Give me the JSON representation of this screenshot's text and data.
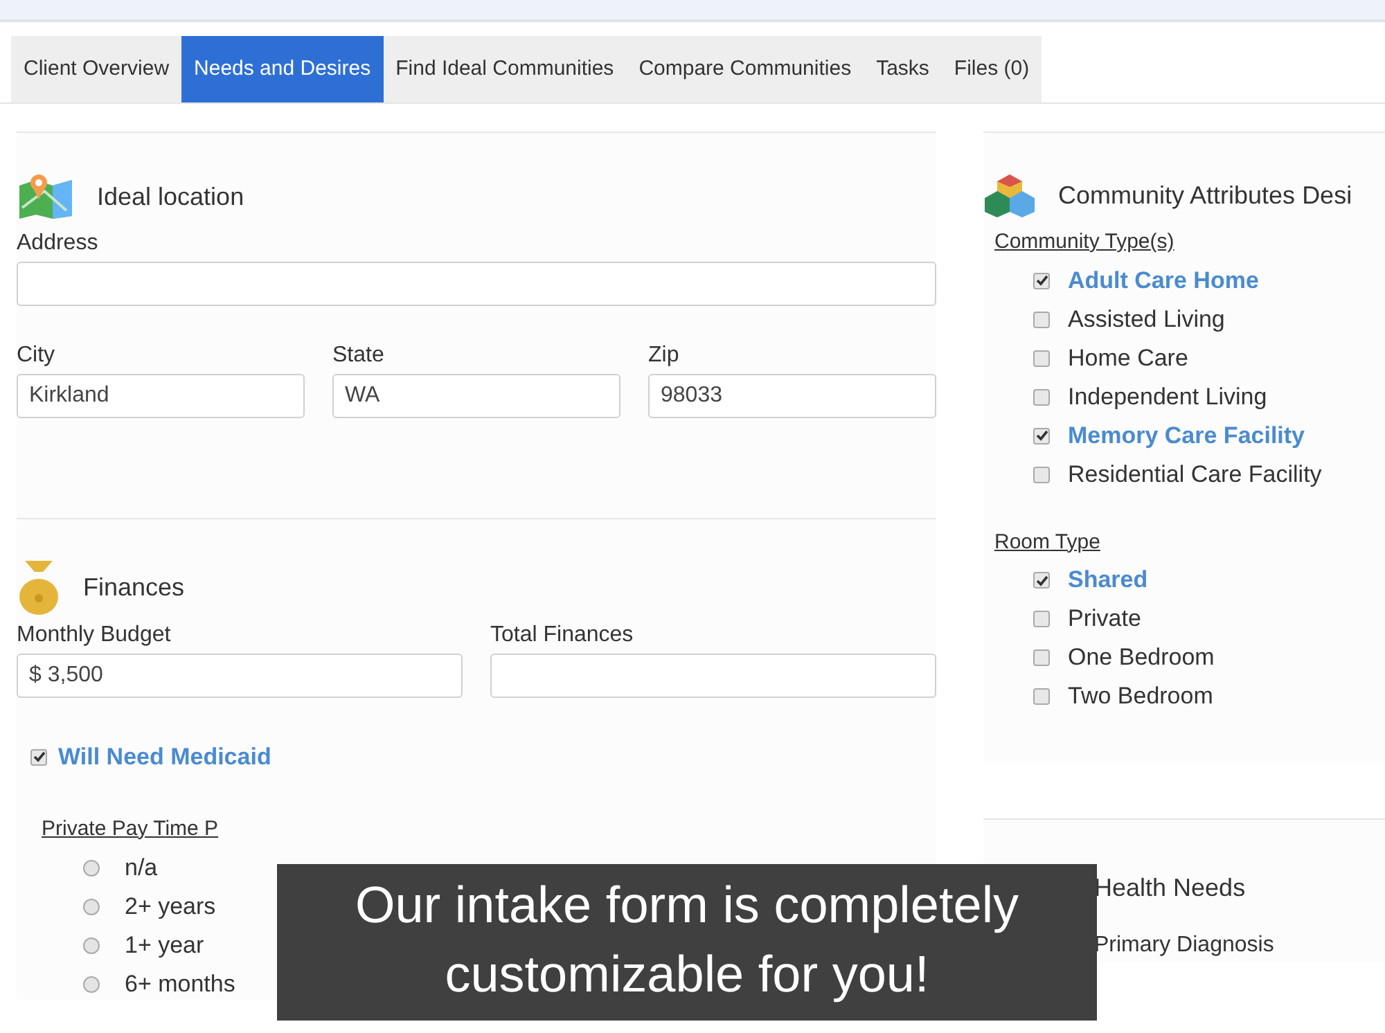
{
  "tabs": [
    {
      "label": "Client Overview",
      "selected": false
    },
    {
      "label": "Needs and Desires",
      "selected": true
    },
    {
      "label": "Find Ideal Communities",
      "selected": false
    },
    {
      "label": "Compare Communities",
      "selected": false
    },
    {
      "label": "Tasks",
      "selected": false
    },
    {
      "label": "Files (0)",
      "selected": false
    }
  ],
  "location": {
    "title": "Ideal location",
    "fields": [
      {
        "label": "Address"
      },
      {
        "label": "City",
        "value": "Kirkland"
      },
      {
        "label": "State",
        "value": "WA"
      },
      {
        "label": "Zip",
        "value": "98033"
      }
    ]
  },
  "finances": {
    "title": "Finances",
    "fields": [
      {
        "label": "Monthly Budget",
        "value": "$ 3,500"
      },
      {
        "label": "Total Finances"
      }
    ],
    "medicaid": {
      "label": "Will Need Medicaid",
      "checked": true
    },
    "private_pay": {
      "title": "Private Pay Time P",
      "options": [
        {
          "label": "n/a",
          "selected": false
        },
        {
          "label": "2+ years",
          "selected": false
        },
        {
          "label": "1+ year",
          "selected": false
        },
        {
          "label": "6+ months",
          "selected": false
        }
      ]
    }
  },
  "attributes": {
    "title": "Community Attributes Desi",
    "groups": [
      {
        "title": "Community Type(s)",
        "items": [
          {
            "label": "Adult Care Home",
            "checked": true
          },
          {
            "label": "Assisted Living",
            "checked": false
          },
          {
            "label": "Home Care",
            "checked": false
          },
          {
            "label": "Independent Living",
            "checked": false
          },
          {
            "label": "Memory Care Facility",
            "checked": true
          },
          {
            "label": "Residential Care Facility",
            "checked": false
          }
        ]
      },
      {
        "title": "Room Type",
        "items": [
          {
            "label": "Shared",
            "checked": true
          },
          {
            "label": "Private",
            "checked": false
          },
          {
            "label": "One Bedroom",
            "checked": false
          },
          {
            "label": "Two Bedroom",
            "checked": false
          }
        ]
      }
    ]
  },
  "health": {
    "title": "Health Needs",
    "fields": [
      {
        "label": "Primary Diagnosis"
      }
    ]
  },
  "caption": {
    "lines": [
      "Our intake form is completely",
      "customizable for you!"
    ]
  }
}
